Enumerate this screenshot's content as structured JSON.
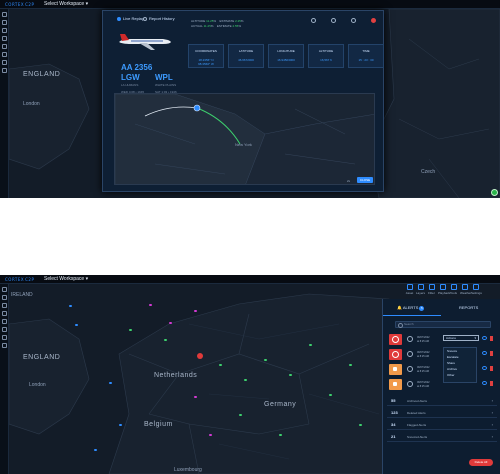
{
  "app": {
    "logo": "CORTEX",
    "logo_sub": "C2P",
    "workspace": "Select Workspace"
  },
  "nav": [
    "Asset",
    "Layers",
    "Filter",
    "Playback",
    "Tools",
    "Weather",
    "Settings"
  ],
  "map_labels": {
    "england": "ENGLAND",
    "ireland": "IRELAND",
    "london": "London",
    "netherlands": "Netherlands",
    "belgium": "Belgium",
    "germany": "Germany",
    "luxembourg": "Luxembourg",
    "czechia": "Czech"
  },
  "modal": {
    "radio_live": "Live Replay",
    "radio_history": "Report History",
    "flight": "AA 2356",
    "origin": "LGW",
    "destination": "WPL",
    "origin_sub": "LA HUMANS",
    "dest_sub": "WHITE PLAINS",
    "origin_time": "WED 4:08 • 1945",
    "dest_time": "SAT 1:03 • 1946",
    "stats": [
      {
        "label": "ALTITUDE",
        "v1": "11.25",
        "u1": "%",
        "label2": "ESTIMATE",
        "v2": "2.25",
        "u2": "%"
      },
      {
        "label": "ACTUAL",
        "v1": "11.25",
        "u1": "%",
        "label2": "ESTIMATE",
        "v2": "2.55",
        "u2": "%"
      }
    ],
    "cards": [
      {
        "title": "COORDINATES",
        "value": "18.2356° N\n98.3560° W"
      },
      {
        "title": "LATITUDE",
        "value": "46.6672000"
      },
      {
        "title": "LONGITUDE",
        "value": "16.94503000"
      },
      {
        "title": "ALTITUDE",
        "value": "16,567 ft"
      },
      {
        "title": "TIME",
        "value": "15 : 23 : 30"
      }
    ],
    "city": "New York",
    "zoom": "2x",
    "close_label": "CLOSE"
  },
  "panel": {
    "tab_alerts": "ALERTS",
    "alerts_count": "5",
    "tab_reports": "REPORTS",
    "search_placeholder": "Search",
    "alerts": [
      {
        "type": "red",
        "date": "06/07/2022",
        "time": "at 8:25 AM",
        "action": "Actions"
      },
      {
        "type": "red",
        "date": "06/07/2022",
        "time": "at 8:25 AM",
        "action": ""
      },
      {
        "type": "orange",
        "date": "06/07/2022",
        "time": "at 8:25 AM",
        "action": ""
      },
      {
        "type": "orange",
        "date": "06/07/2022",
        "time": "at 8:25 AM",
        "action": ""
      }
    ],
    "dropdown": [
      "Snooze",
      "Escalate",
      "Share",
      "Archive",
      "Other"
    ],
    "stats": [
      {
        "n": "55",
        "label": "Archived Alerts"
      },
      {
        "n": "123",
        "label": "Deleted Alerts"
      },
      {
        "n": "34",
        "label": "Flagged Alerts"
      },
      {
        "n": "21",
        "label": "Snoozed Alerts"
      }
    ],
    "delete_all": "Delete All"
  }
}
